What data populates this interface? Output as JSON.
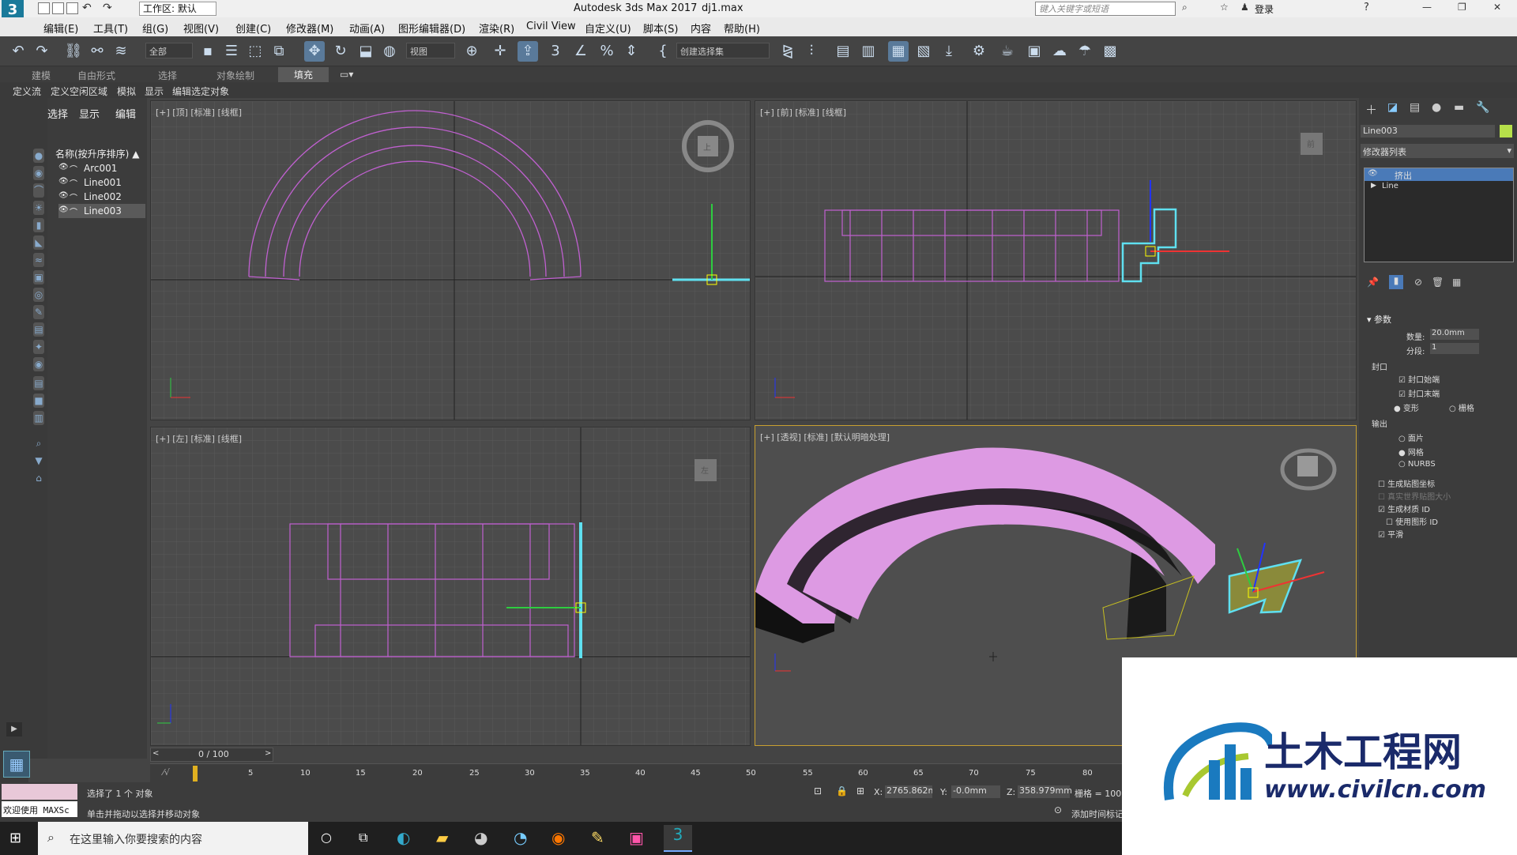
{
  "titlebar": {
    "workspace_label": "工作区: 默认",
    "app_title": "Autodesk 3ds Max 2017",
    "file_name": "dj1.max",
    "search_placeholder": "键入关键字或短语",
    "login_label": "登录"
  },
  "menu": [
    "编辑(E)",
    "工具(T)",
    "组(G)",
    "视图(V)",
    "创建(C)",
    "修改器(M)",
    "动画(A)",
    "图形编辑器(D)",
    "渲染(R)",
    "Civil View",
    "自定义(U)",
    "脚本(S)",
    "内容",
    "帮助(H)"
  ],
  "toolbar": {
    "selection_filter": "全部",
    "coord_system": "视图",
    "named_selection": "创建选择集"
  },
  "ribbon_tabs": [
    "建模",
    "自由形式",
    "选择",
    "对象绘制",
    "填充"
  ],
  "ribbon_subtabs": [
    "定义流",
    "定义空闲区域",
    "模拟",
    "显示",
    "编辑选定对象"
  ],
  "scene_explorer": {
    "tabs": [
      "选择",
      "显示",
      "编辑"
    ],
    "column_header": "名称(按升序排序)",
    "items": [
      {
        "name": "Arc001",
        "selected": false
      },
      {
        "name": "Line001",
        "selected": false
      },
      {
        "name": "Line002",
        "selected": false
      },
      {
        "name": "Line003",
        "selected": true
      }
    ]
  },
  "viewports": {
    "top": "[+] [顶] [标准] [线框]",
    "front": "[+] [前] [标准] [线框]",
    "left": "[+] [左] [标准] [线框]",
    "persp": "[+] [透视] [标准] [默认明暗处理]",
    "cube_top": "上",
    "cube_front": "前",
    "cube_left": "左"
  },
  "command_panel": {
    "object_name": "Line003",
    "object_color": "#b6e04a",
    "modifier_list": "修改器列表",
    "stack": [
      "挤出",
      "Line"
    ],
    "rollout_title": "参数",
    "amount_label": "数量:",
    "amount_value": "20.0mm",
    "segments_label": "分段:",
    "segments_value": "1",
    "capping_label": "封口",
    "cap_start": "封口始端",
    "cap_end": "封口末端",
    "morph": "变形",
    "grid": "栅格",
    "output_label": "输出",
    "patch": "面片",
    "mesh": "网格",
    "nurbs": "NURBS",
    "gen_map_coords": "生成贴图坐标",
    "real_world_map": "真实世界贴图大小",
    "gen_mat_ids": "生成材质 ID",
    "use_shape_ids": "使用图形 ID",
    "smooth": "平滑"
  },
  "timeline": {
    "frame_readout": "0 / 100",
    "ticks": [
      "5",
      "10",
      "15",
      "20",
      "25",
      "30",
      "35",
      "40",
      "45",
      "50",
      "55",
      "60",
      "65",
      "70",
      "75",
      "80"
    ]
  },
  "status": {
    "maxscript": "欢迎使用 MAXSc",
    "selected": "选择了 1 个 对象",
    "prompt": "单击并拖动以选择并移动对象",
    "x_label": "X:",
    "x_value": "2765.862m",
    "y_label": "Y:",
    "y_value": "-0.0mm",
    "z_label": "Z:",
    "z_value": "358.979mm",
    "grid_label": "栅格 = 100.0",
    "add_time_tag": "添加时间标记"
  },
  "taskbar": {
    "search_placeholder": "在这里输入你要搜索的内容"
  },
  "watermark": {
    "brand": "土木工程网",
    "url": "www.civilcn.com"
  },
  "colors": {
    "wire": "#c060d0",
    "shape_selected": "#5fe0f0",
    "solid": "#dd9ae3",
    "active_border": "#c8a030"
  }
}
